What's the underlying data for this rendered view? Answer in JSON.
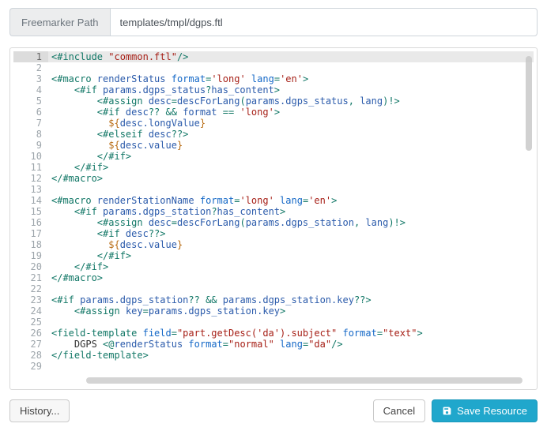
{
  "path": {
    "label": "Freemarker Path",
    "value": "templates/tmpl/dgps.ftl"
  },
  "buttons": {
    "history": "History...",
    "cancel": "Cancel",
    "save": "Save Resource"
  },
  "active_line": 1,
  "code_lines": [
    [
      [
        "tag",
        "<#include "
      ],
      [
        "str",
        "\"common.ftl\""
      ],
      [
        "tag",
        "/>"
      ]
    ],
    [],
    [
      [
        "tag",
        "<#macro "
      ],
      [
        "var",
        "renderStatus"
      ],
      [
        "plain",
        " "
      ],
      [
        "attr",
        "format"
      ],
      [
        "tag",
        "="
      ],
      [
        "str",
        "'long'"
      ],
      [
        "plain",
        " "
      ],
      [
        "attr",
        "lang"
      ],
      [
        "tag",
        "="
      ],
      [
        "str",
        "'en'"
      ],
      [
        "tag",
        ">"
      ]
    ],
    [
      [
        "plain",
        "    "
      ],
      [
        "tag",
        "<#if "
      ],
      [
        "var",
        "params.dgps_status"
      ],
      [
        "tag",
        "?"
      ],
      [
        "var",
        "has_content"
      ],
      [
        "tag",
        ">"
      ]
    ],
    [
      [
        "plain",
        "        "
      ],
      [
        "tag",
        "<#assign "
      ],
      [
        "var",
        "desc"
      ],
      [
        "tag",
        "="
      ],
      [
        "var",
        "descForLang"
      ],
      [
        "tag",
        "("
      ],
      [
        "var",
        "params.dgps_status"
      ],
      [
        "tag",
        ", "
      ],
      [
        "var",
        "lang"
      ],
      [
        "tag",
        ")!>"
      ]
    ],
    [
      [
        "plain",
        "        "
      ],
      [
        "tag",
        "<#if "
      ],
      [
        "var",
        "desc"
      ],
      [
        "tag",
        "?? && "
      ],
      [
        "var",
        "format"
      ],
      [
        "tag",
        " == "
      ],
      [
        "str",
        "'long'"
      ],
      [
        "tag",
        ">"
      ]
    ],
    [
      [
        "plain",
        "          "
      ],
      [
        "ent",
        "${"
      ],
      [
        "var",
        "desc.longValue"
      ],
      [
        "ent",
        "}"
      ]
    ],
    [
      [
        "plain",
        "        "
      ],
      [
        "tag",
        "<#elseif "
      ],
      [
        "var",
        "desc"
      ],
      [
        "tag",
        "??>"
      ]
    ],
    [
      [
        "plain",
        "          "
      ],
      [
        "ent",
        "${"
      ],
      [
        "var",
        "desc.value"
      ],
      [
        "ent",
        "}"
      ]
    ],
    [
      [
        "plain",
        "        "
      ],
      [
        "tag",
        "</#if>"
      ]
    ],
    [
      [
        "plain",
        "    "
      ],
      [
        "tag",
        "</#if>"
      ]
    ],
    [
      [
        "tag",
        "</#macro>"
      ]
    ],
    [],
    [
      [
        "tag",
        "<#macro "
      ],
      [
        "var",
        "renderStationName"
      ],
      [
        "plain",
        " "
      ],
      [
        "attr",
        "format"
      ],
      [
        "tag",
        "="
      ],
      [
        "str",
        "'long'"
      ],
      [
        "plain",
        " "
      ],
      [
        "attr",
        "lang"
      ],
      [
        "tag",
        "="
      ],
      [
        "str",
        "'en'"
      ],
      [
        "tag",
        ">"
      ]
    ],
    [
      [
        "plain",
        "    "
      ],
      [
        "tag",
        "<#if "
      ],
      [
        "var",
        "params.dgps_station"
      ],
      [
        "tag",
        "?"
      ],
      [
        "var",
        "has_content"
      ],
      [
        "tag",
        ">"
      ]
    ],
    [
      [
        "plain",
        "        "
      ],
      [
        "tag",
        "<#assign "
      ],
      [
        "var",
        "desc"
      ],
      [
        "tag",
        "="
      ],
      [
        "var",
        "descForLang"
      ],
      [
        "tag",
        "("
      ],
      [
        "var",
        "params.dgps_station"
      ],
      [
        "tag",
        ", "
      ],
      [
        "var",
        "lang"
      ],
      [
        "tag",
        ")!>"
      ]
    ],
    [
      [
        "plain",
        "        "
      ],
      [
        "tag",
        "<#if "
      ],
      [
        "var",
        "desc"
      ],
      [
        "tag",
        "??>"
      ]
    ],
    [
      [
        "plain",
        "          "
      ],
      [
        "ent",
        "${"
      ],
      [
        "var",
        "desc.value"
      ],
      [
        "ent",
        "}"
      ]
    ],
    [
      [
        "plain",
        "        "
      ],
      [
        "tag",
        "</#if>"
      ]
    ],
    [
      [
        "plain",
        "    "
      ],
      [
        "tag",
        "</#if>"
      ]
    ],
    [
      [
        "tag",
        "</#macro>"
      ]
    ],
    [],
    [
      [
        "tag",
        "<#if "
      ],
      [
        "var",
        "params.dgps_station"
      ],
      [
        "tag",
        "?? && "
      ],
      [
        "var",
        "params.dgps_station.key"
      ],
      [
        "tag",
        "??>"
      ]
    ],
    [
      [
        "plain",
        "    "
      ],
      [
        "tag",
        "<#assign "
      ],
      [
        "var",
        "key"
      ],
      [
        "tag",
        "="
      ],
      [
        "var",
        "params.dgps_station.key"
      ],
      [
        "tag",
        ">"
      ]
    ],
    [],
    [
      [
        "tag",
        "<field-template "
      ],
      [
        "attr",
        "field"
      ],
      [
        "tag",
        "="
      ],
      [
        "str",
        "\"part.getDesc('da').subject\""
      ],
      [
        "plain",
        " "
      ],
      [
        "attr",
        "format"
      ],
      [
        "tag",
        "="
      ],
      [
        "str",
        "\"text\""
      ],
      [
        "tag",
        ">"
      ]
    ],
    [
      [
        "plain",
        "    DGPS "
      ],
      [
        "tag",
        "<@"
      ],
      [
        "var",
        "renderStatus"
      ],
      [
        "plain",
        " "
      ],
      [
        "attr",
        "format"
      ],
      [
        "tag",
        "="
      ],
      [
        "str",
        "\"normal\""
      ],
      [
        "plain",
        " "
      ],
      [
        "attr",
        "lang"
      ],
      [
        "tag",
        "="
      ],
      [
        "str",
        "\"da\""
      ],
      [
        "tag",
        "/>"
      ]
    ],
    [
      [
        "tag",
        "</field-template>"
      ]
    ],
    []
  ]
}
